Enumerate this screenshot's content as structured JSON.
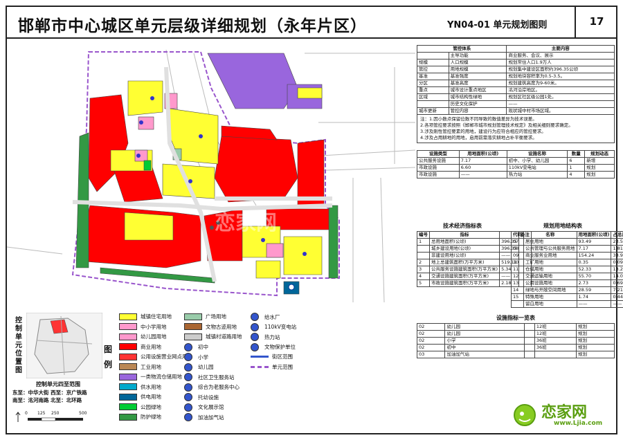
{
  "header": {
    "title": "邯郸市中心城区单元层级详细规划（永年片区）",
    "plan_code": "YN04-01 单元规划图则",
    "sheet_no": "17"
  },
  "map": {
    "watermark": "恋家网"
  },
  "control_table": {
    "col1": "管控体系",
    "col2": "主要内容",
    "rows": [
      {
        "a": "",
        "b": "主导功能",
        "c": "商业服务、会议、展示"
      },
      {
        "a": "规模",
        "b": "人口规模",
        "c": "规划常住人口1.9万人"
      },
      {
        "a": "管控",
        "b": "用地规模",
        "c": "规划集中建设区面积约396.35公顷"
      },
      {
        "a": "基准",
        "b": "基准强度",
        "c": "规划地块容积率为0.5-3.5。"
      },
      {
        "a": "分区",
        "b": "基准高度",
        "c": "规划建筑高度为9-60米。"
      },
      {
        "a": "重点",
        "b": "城市设计重点地区",
        "c": "洺河沿岸地区。"
      },
      {
        "a": "区域",
        "b": "城市结构性绿地",
        "c": "规划区社区级公园1处。"
      },
      {
        "a": "",
        "b": "历史文化保护",
        "c": "——"
      },
      {
        "a": "城市更新",
        "b": "管控内容",
        "c": "现状城中村市场区域。"
      }
    ],
    "notes": [
      "注：1.因小数点保留位数不同导致的数值差异为技术误差。",
      "2.各项管控要求按照《邯郸市城市规划管理技术规定》及相关细则要求确定。",
      "3.涉及刚性管控要素的用地，建设行为应符合相应的管控要求。",
      "4.涉及占用耕地的用地，启用前需落实耕地占补平衡要求。"
    ]
  },
  "facility_table": {
    "headers": [
      "设施类型",
      "用地面积(公顷)",
      "设施名称",
      "数量",
      "规划动态"
    ],
    "rows": [
      [
        "公共服务设施",
        "7.17",
        "初中、小学、幼儿园",
        "6",
        "新增"
      ],
      [
        "市政设施",
        "6.60",
        "110kV变电站",
        "1",
        "规划"
      ],
      [
        "市政设施",
        "——",
        "热力站",
        "4",
        "规划"
      ]
    ]
  },
  "econ_table": {
    "title": "技术经济指标表",
    "headers": [
      "编号",
      "指标",
      "",
      "备注"
    ],
    "rows": [
      [
        "1",
        "总用地面积(公顷)",
        "396.35",
        ""
      ],
      [
        "",
        "城乡建设用地(公顷)",
        "396.35",
        ""
      ],
      [
        "",
        "非建设用地(公顷)",
        "——",
        ""
      ],
      [
        "2",
        "地上总建筑面积(万平方米)",
        "519.11",
        ""
      ],
      [
        "3",
        "公共服务设施建筑面积(万平方米)",
        "5.34",
        ""
      ],
      [
        "4",
        "交通设施建筑面积(万平方米)",
        "——",
        ""
      ],
      [
        "5",
        "市政设施建筑面积(万平方米)",
        "2.18",
        ""
      ]
    ]
  },
  "landuse_table": {
    "title": "规划用地结构表",
    "headers": [
      "代码",
      "名称",
      "用地面积(公顷)",
      "占总用地比例(%)"
    ],
    "rows": [
      [
        "07",
        "居住用地",
        "93.49",
        "23.59"
      ],
      [
        "08",
        "公共管理与公共服务用地",
        "7.17",
        "1.81"
      ],
      [
        "09",
        "商业服务业用地",
        "154.24",
        "38.92"
      ],
      [
        "10",
        "工矿用地",
        "0.35",
        "0.09"
      ],
      [
        "11",
        "仓储用地",
        "52.33",
        "13.20"
      ],
      [
        "12",
        "交通运输用地",
        "55.70",
        "14.05"
      ],
      [
        "13",
        "公用设施用地",
        "2.73",
        "0.69"
      ],
      [
        "14",
        "绿地与开敞空间用地",
        "28.59",
        "7.21"
      ],
      [
        "15",
        "特殊用地",
        "1.74",
        "0.44"
      ],
      [
        "",
        "留白用地",
        "——",
        "——"
      ]
    ]
  },
  "facility_list": {
    "title": "设施指标一览表",
    "rows": [
      [
        "02",
        "幼儿园",
        "",
        "12班",
        "规划"
      ],
      [
        "02",
        "幼儿园",
        "",
        "12班",
        "规划"
      ],
      [
        "02",
        "小学",
        "",
        "36班",
        "规划"
      ],
      [
        "02",
        "初中",
        "",
        "36班",
        "规划"
      ],
      [
        "03",
        "加油加气站",
        "",
        "",
        "规划"
      ]
    ]
  },
  "legend": {
    "title": "图例",
    "items": [
      {
        "label": "城镇住宅用地",
        "color": "#ffff33"
      },
      {
        "label": "中小学用地",
        "color": "#ff99cc"
      },
      {
        "label": "幼儿园用地",
        "color": "#ff99cc"
      },
      {
        "label": "商业用地",
        "color": "#ff0000"
      },
      {
        "label": "公用设施营业网点用地",
        "color": "#ff3333"
      },
      {
        "label": "工业用地",
        "color": "#bb8855"
      },
      {
        "label": "一类物流仓储用地",
        "color": "#9966dd"
      },
      {
        "label": "供水用地",
        "color": "#00aacc"
      },
      {
        "label": "供电用地",
        "color": "#006699"
      },
      {
        "label": "公园绿地",
        "color": "#00cc33"
      },
      {
        "label": "防护绿地",
        "color": "#339944"
      },
      {
        "label": "广场用地",
        "color": "#99ccaa"
      },
      {
        "label": "文物古迹用地",
        "color": "#aa6633"
      },
      {
        "label": "城镇村道路用地",
        "color": "#cccccc"
      },
      {
        "label": "初中",
        "icon": "circle"
      },
      {
        "label": "小学",
        "icon": "circle"
      },
      {
        "label": "幼儿园",
        "icon": "circle"
      },
      {
        "label": "社区卫生服务站",
        "icon": "circle"
      },
      {
        "label": "综合为老服务中心",
        "icon": "circle"
      },
      {
        "label": "托幼设施",
        "icon": "circle"
      },
      {
        "label": "文化展示馆",
        "icon": "circle"
      },
      {
        "label": "加油加气站",
        "icon": "circle"
      },
      {
        "label": "给水厂",
        "icon": "circle"
      },
      {
        "label": "110kV变电站",
        "icon": "circle"
      },
      {
        "label": "热力站",
        "icon": "circle"
      },
      {
        "label": "文物保护单位",
        "icon": "circle"
      },
      {
        "label": "街区范围",
        "icon": "line-blue"
      },
      {
        "label": "单元范围",
        "icon": "line-purple"
      }
    ]
  },
  "location": {
    "label": "控制单元位置图",
    "range_title": "控制单元四至范围",
    "east_west": "东至：中华大街 西至：京广铁路",
    "south_north": "南至：洺河南路 北至：北环路"
  },
  "scale": {
    "ticks": [
      "0",
      "125",
      "250",
      "500"
    ]
  },
  "brand": {
    "name": "恋家网",
    "url": "www.Ljia.com"
  }
}
